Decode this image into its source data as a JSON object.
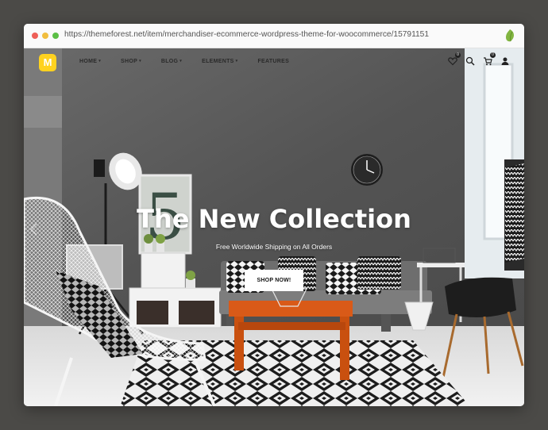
{
  "browser": {
    "url": "https://themeforest.net/item/merchandiser-ecommerce-wordpress-theme-for-woocommerce/15791151",
    "extension_icon": "leaf-icon"
  },
  "nav": {
    "logo": "M",
    "items": [
      {
        "label": "HOME",
        "has_dropdown": true
      },
      {
        "label": "SHOP",
        "has_dropdown": true
      },
      {
        "label": "BLOG",
        "has_dropdown": true
      },
      {
        "label": "ELEMENTS",
        "has_dropdown": true
      },
      {
        "label": "FEATURES",
        "has_dropdown": false
      }
    ],
    "caret": "▾",
    "icons": [
      {
        "name": "wishlist-heart-icon",
        "badge": "0"
      },
      {
        "name": "search-icon"
      },
      {
        "name": "cart-icon",
        "badge": "0"
      },
      {
        "name": "account-icon"
      }
    ]
  },
  "hero": {
    "title": "The New Collection",
    "subtitle": "Free Worldwide Shipping on All Orders",
    "button": "SHOP NOW!"
  },
  "colors": {
    "logo_bg": "#ffd21f",
    "wall": "#5a5a5a",
    "table": "#d95a18",
    "page_bg": "#4b4a47"
  }
}
